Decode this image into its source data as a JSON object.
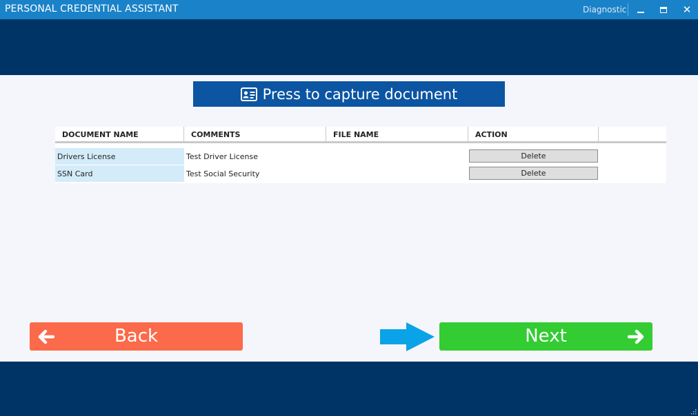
{
  "window": {
    "title": "PERSONAL CREDENTIAL ASSISTANT",
    "diagnostic_label": "Diagnostic"
  },
  "capture": {
    "label": "Press to capture document",
    "icon": "id-card-icon"
  },
  "table": {
    "headers": [
      "DOCUMENT NAME",
      "COMMENTS",
      "FILE NAME",
      "ACTION"
    ],
    "rows": [
      {
        "name": "Drivers License",
        "comment": "Test Driver License",
        "file": "",
        "action": "Delete"
      },
      {
        "name": "SSN Card",
        "comment": "Test Social Security",
        "file": "",
        "action": "Delete"
      }
    ]
  },
  "nav": {
    "back_label": "Back",
    "next_label": "Next"
  },
  "colors": {
    "titlebar": "#1a82c8",
    "band": "#003466",
    "capture_button": "#0c55a2",
    "back_button": "#fb6a4a",
    "next_button": "#33cc33",
    "hint_arrow": "#0aa3e8",
    "name_cell": "#d4ebf9"
  }
}
